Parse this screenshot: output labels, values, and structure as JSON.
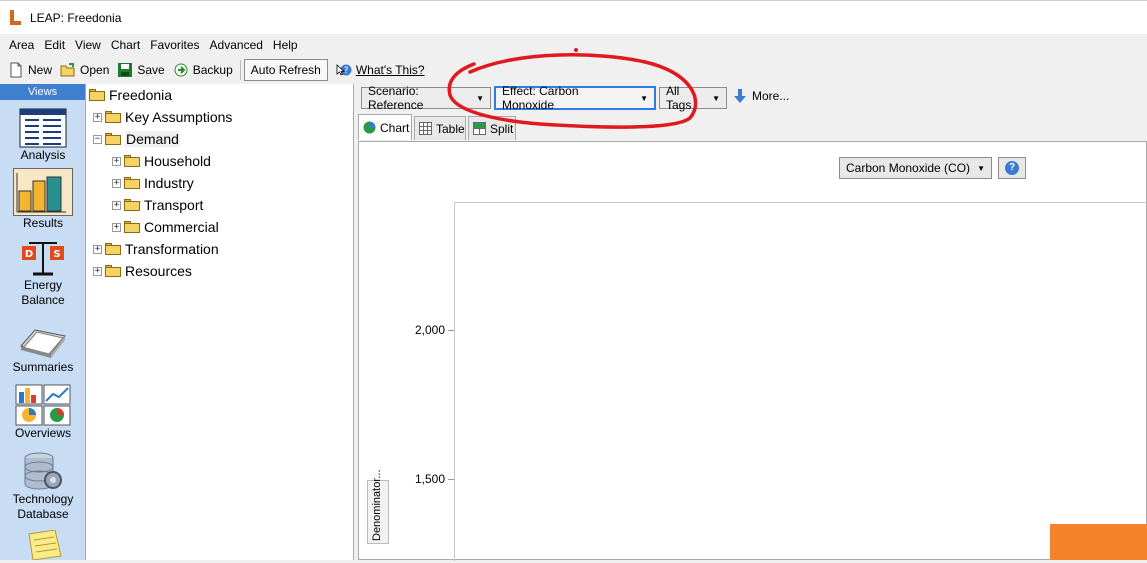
{
  "window": {
    "title": "LEAP: Freedonia"
  },
  "menu": [
    "Area",
    "Edit",
    "View",
    "Chart",
    "Favorites",
    "Advanced",
    "Help"
  ],
  "toolbar": {
    "new_label": "New",
    "open_label": "Open",
    "save_label": "Save",
    "backup_label": "Backup",
    "auto_refresh_label": "Auto Refresh",
    "whats_this_label": "What's This?"
  },
  "views": {
    "header": "Views",
    "analysis": "Analysis",
    "results": "Results",
    "energy_balance_1": "Energy",
    "energy_balance_2": "Balance",
    "summaries": "Summaries",
    "overviews": "Overviews",
    "tech_db_1": "Technology",
    "tech_db_2": "Database"
  },
  "tree": {
    "root": "Freedonia",
    "key_assumptions": "Key Assumptions",
    "demand": "Demand",
    "household": "Household",
    "industry": "Industry",
    "transport": "Transport",
    "commercial": "Commercial",
    "transformation": "Transformation",
    "resources": "Resources"
  },
  "controls": {
    "scenario": "Scenario: Reference",
    "effect": "Effect: Carbon Monoxide",
    "tags": "All Tags",
    "more": "More..."
  },
  "tabs": {
    "chart": "Chart",
    "table": "Table",
    "split": "Split"
  },
  "chart_panel": {
    "pollutant_selector": "Carbon Monoxide (CO)",
    "help_icon": "?"
  },
  "chart_data": {
    "type": "bar",
    "ytick_labels": [
      "2,000",
      "1,500"
    ],
    "ylabel": "Denominator...",
    "colors": {
      "bar": "#f5832b"
    }
  },
  "colors": {
    "views_bg": "#c8dcf3",
    "views_header": "#3e7fd0",
    "annotation": "#e0191e",
    "active_border": "#2f7de1"
  }
}
